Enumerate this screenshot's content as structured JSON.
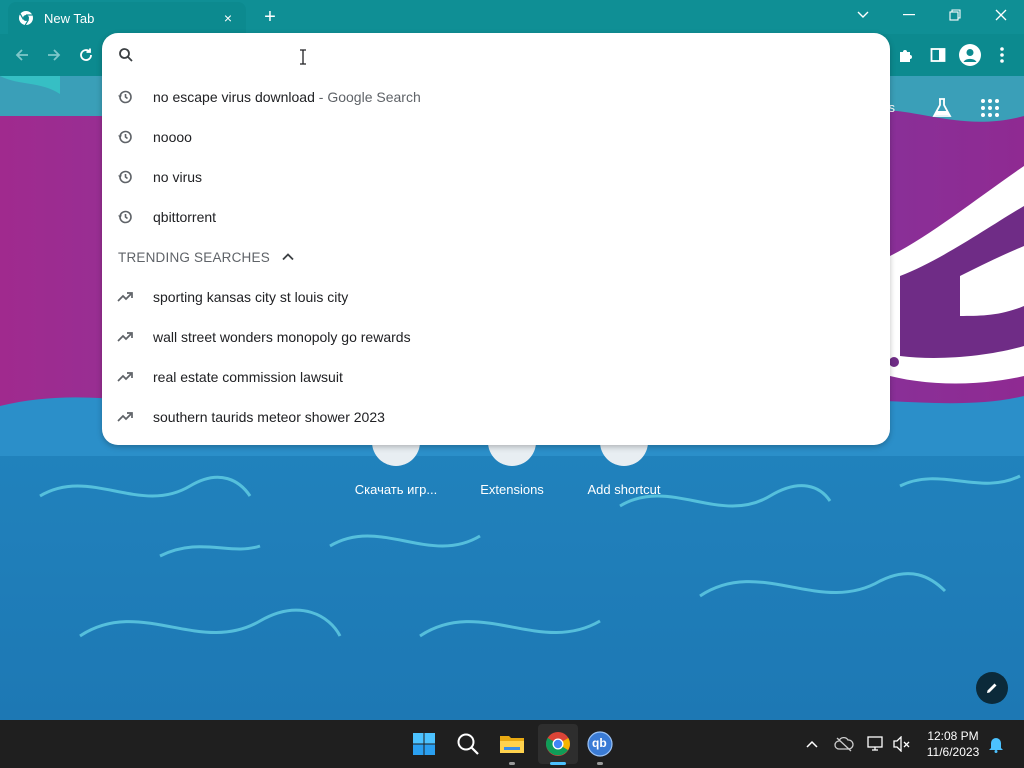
{
  "browser": {
    "tab": {
      "title": "New Tab",
      "close_label": "×"
    },
    "new_tab_label": "+"
  },
  "colors": {
    "titlebar": "#0f8f95",
    "toolbar": "#0c8a8f",
    "omnibox_bg": "#ffffff",
    "suggestion_text": "#202124",
    "muted_text": "#5f6368",
    "taskbar": "#1f1f1f"
  },
  "omnibox": {
    "value": "",
    "search_icon": "search-icon",
    "suggestions": [
      {
        "icon": "history-icon",
        "text": "no escape virus download",
        "suffix": " - Google Search"
      },
      {
        "icon": "history-icon",
        "text": "noooo"
      },
      {
        "icon": "history-icon",
        "text": "no virus"
      },
      {
        "icon": "history-icon",
        "text": "qbittorrent"
      }
    ],
    "trending_header": "TRENDING SEARCHES",
    "trending": [
      {
        "icon": "trending-icon",
        "text": "sporting kansas city st louis city"
      },
      {
        "icon": "trending-icon",
        "text": "wall street wonders monopoly go rewards"
      },
      {
        "icon": "trending-icon",
        "text": "real estate commission lawsuit"
      },
      {
        "icon": "trending-icon",
        "text": "southern taurids meteor shower 2023"
      }
    ]
  },
  "ntp": {
    "topright_link": "ges",
    "shortcuts": [
      {
        "label": "Скачать игр...",
        "icon": "game-icon"
      },
      {
        "label": "Extensions",
        "icon": "web-store-icon"
      },
      {
        "label": "Add shortcut",
        "icon": "plus-icon"
      }
    ]
  },
  "taskbar": {
    "apps": [
      "windows-start-icon",
      "search-icon",
      "file-explorer-icon",
      "chrome-icon",
      "qbittorrent-icon"
    ],
    "qbittorrent_label": "qb",
    "clock": {
      "time": "12:08 PM",
      "date": "11/6/2023"
    }
  }
}
